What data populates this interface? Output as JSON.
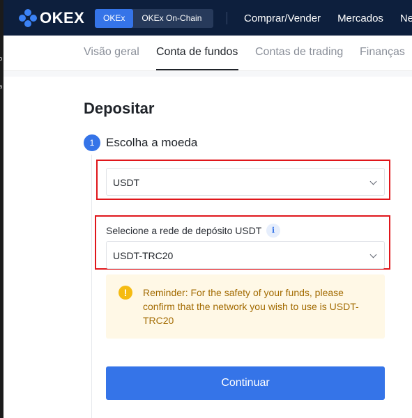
{
  "left_strip": {
    "glyph1": "o",
    "glyph2": "a"
  },
  "brand": {
    "name": "OKEX"
  },
  "network_switch": {
    "options": [
      "OKEx",
      "OKEx On-Chain"
    ],
    "active": "OKEx"
  },
  "top_nav": {
    "items": [
      "Comprar/Vender",
      "Mercados",
      "Neg"
    ]
  },
  "sub_nav": {
    "tabs": [
      "Visão geral",
      "Conta de fundos",
      "Contas de trading",
      "Finanças"
    ],
    "active": "Conta de fundos"
  },
  "page": {
    "title": "Depositar",
    "step_number": "1",
    "step_label": "Escolha a moeda"
  },
  "currency_select": {
    "value": "USDT"
  },
  "network_select": {
    "label": "Selecione a rede de depósito USDT",
    "value": "USDT-TRC20",
    "info_icon": "i"
  },
  "reminder": {
    "icon": "!",
    "text": "Reminder: For the safety of your funds, please confirm that the network you wish to use is USDT-TRC20"
  },
  "actions": {
    "continue_label": "Continuar"
  },
  "colors": {
    "header_bg": "#0d1f3d",
    "accent": "#3574e8",
    "highlight_red": "#e0161b",
    "reminder_bg": "#fff8e6",
    "reminder_text": "#a26a00"
  }
}
